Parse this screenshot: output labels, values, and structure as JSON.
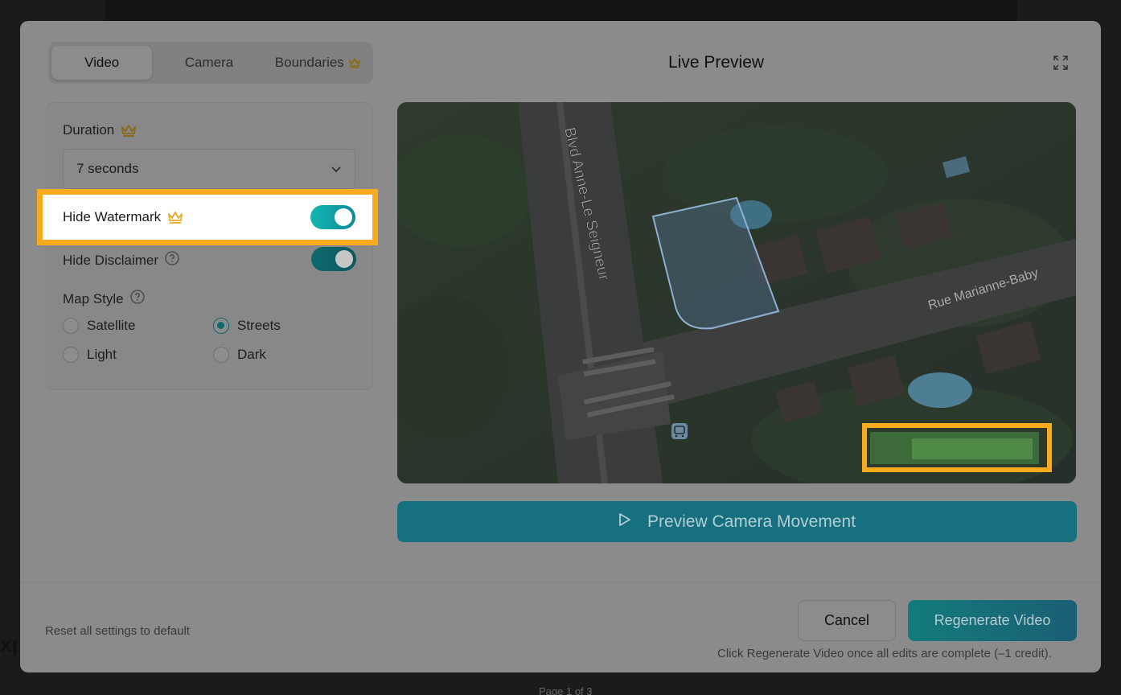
{
  "background": {
    "side_text": "xp",
    "bottom_text": "Page 1 of 3"
  },
  "tabs": [
    {
      "label": "Video",
      "active": true
    },
    {
      "label": "Camera",
      "active": false
    },
    {
      "label": "Boundaries",
      "active": false,
      "premium": true
    }
  ],
  "preview": {
    "title": "Live Preview",
    "button_label": "Preview Camera Movement"
  },
  "settings": {
    "duration_label": "Duration",
    "duration_value": "7 seconds",
    "hide_watermark_label": "Hide Watermark",
    "hide_watermark_on": true,
    "hide_disclaimer_label": "Hide Disclaimer",
    "hide_disclaimer_on": true,
    "map_style_label": "Map Style",
    "map_styles": [
      {
        "label": "Satellite",
        "checked": false
      },
      {
        "label": "Streets",
        "checked": true
      },
      {
        "label": "Light",
        "checked": false
      },
      {
        "label": "Dark",
        "checked": false
      }
    ]
  },
  "map": {
    "street_1": "Blvd Anne-Le Seigneur",
    "street_2": "Rue Marianne-Baby"
  },
  "footer": {
    "reset_label": "Reset all settings to default",
    "cancel_label": "Cancel",
    "regenerate_label": "Regenerate Video",
    "note": "Click Regenerate Video once all edits are complete (–1 credit)."
  },
  "colors": {
    "highlight": "#f9ab1e",
    "accent": "#12b7b0",
    "premium_crown": "#d8a21a"
  }
}
